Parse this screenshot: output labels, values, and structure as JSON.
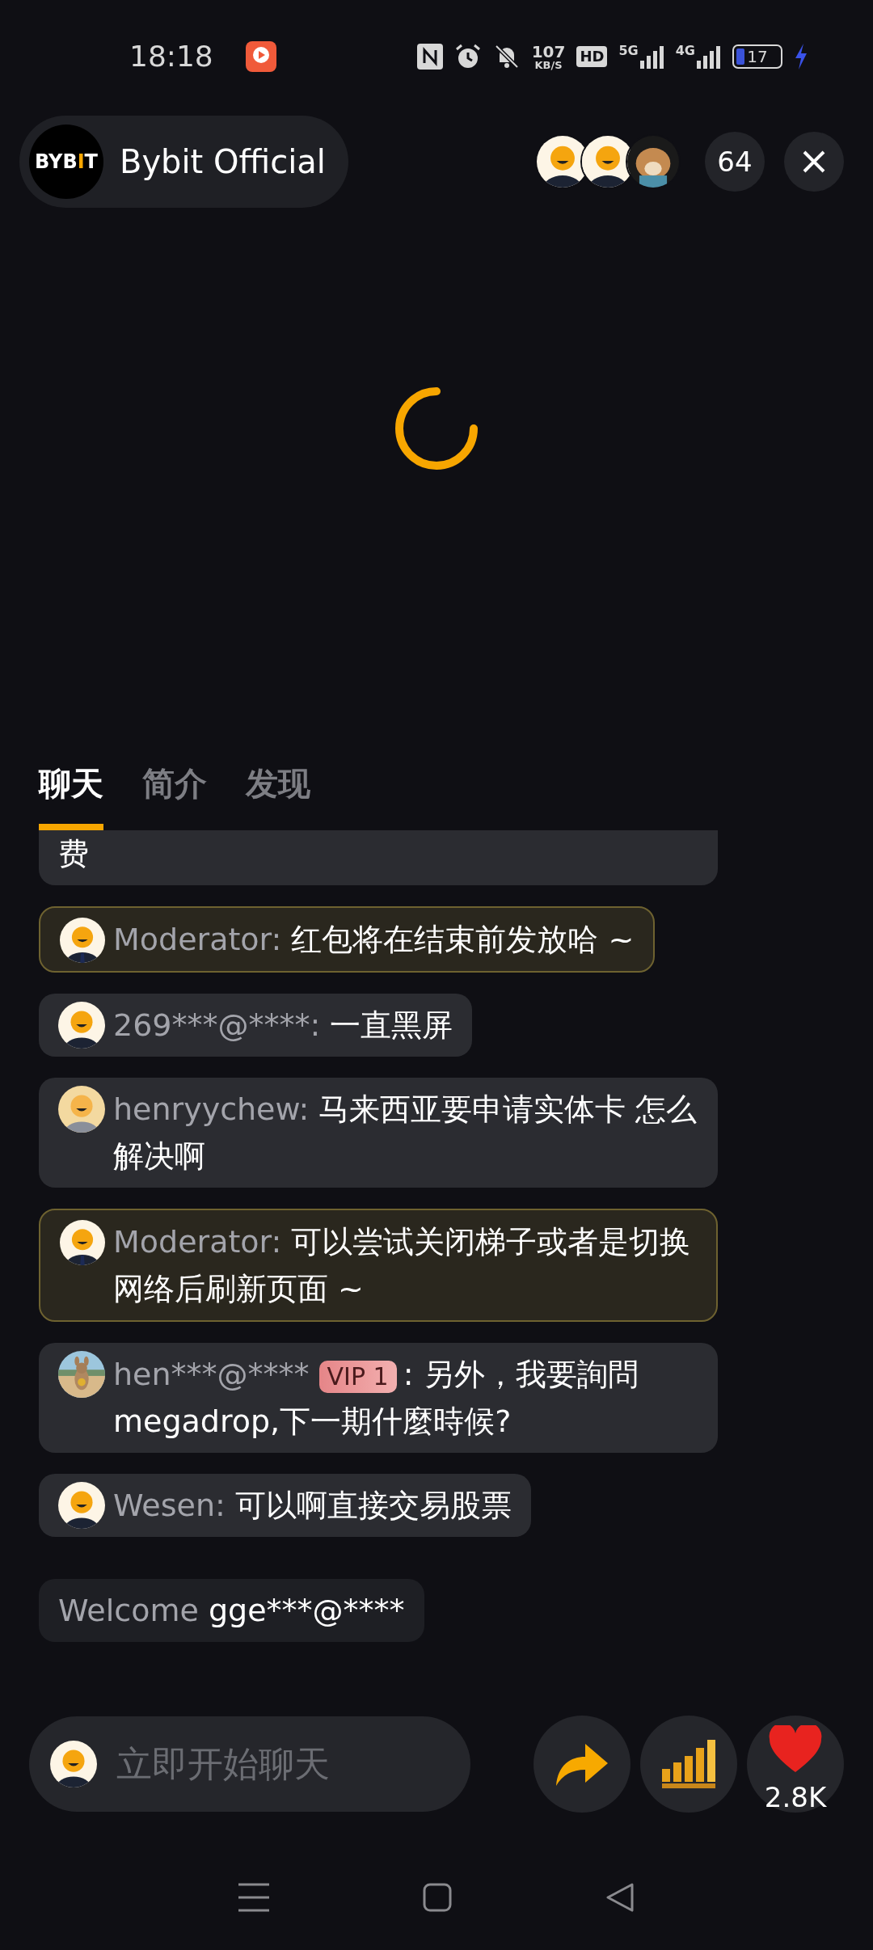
{
  "status_bar": {
    "time": "18:18",
    "speed": "107",
    "speed_unit": "KB/S",
    "hd": "HD",
    "net1": "5G",
    "net2": "4G",
    "battery": "17"
  },
  "header": {
    "logo": [
      "BYB",
      "I",
      "T"
    ],
    "title": "Bybit Official",
    "viewers": "64"
  },
  "tabs": [
    {
      "label": "聊天",
      "selected": true
    },
    {
      "label": "简介",
      "selected": false
    },
    {
      "label": "发现",
      "selected": false
    }
  ],
  "messages": [
    {
      "kind": "cut",
      "text": "费"
    },
    {
      "kind": "moderator",
      "name": "Moderator:",
      "text": "红包将在结束前发放哈 ~"
    },
    {
      "kind": "user",
      "avatar": {
        "kind": "default"
      },
      "name": "269***@****:",
      "text": "一直黑屏"
    },
    {
      "kind": "user",
      "avatar": {
        "kind": "light"
      },
      "name": "henryychew:",
      "text": "马来西亚要申请实体卡 怎么解决啊"
    },
    {
      "kind": "moderator",
      "name": "Moderator:",
      "text": "可以尝试关闭梯子或者是切换网络后刷新页面 ~"
    },
    {
      "kind": "user",
      "name": "hen***@****",
      "badge": "VIP 1",
      "text": ": 另外，我要詢問 megadrop,下一期什麼時候?"
    },
    {
      "kind": "user",
      "avatar": {
        "kind": "default"
      },
      "name": "Wesen:",
      "text": "可以啊直接交易股票"
    },
    {
      "kind": "welcome",
      "name": "Welcome",
      "text": "gge***@****"
    }
  ],
  "composer": {
    "placeholder": "立即开始聊天"
  },
  "likes": "2.8K"
}
